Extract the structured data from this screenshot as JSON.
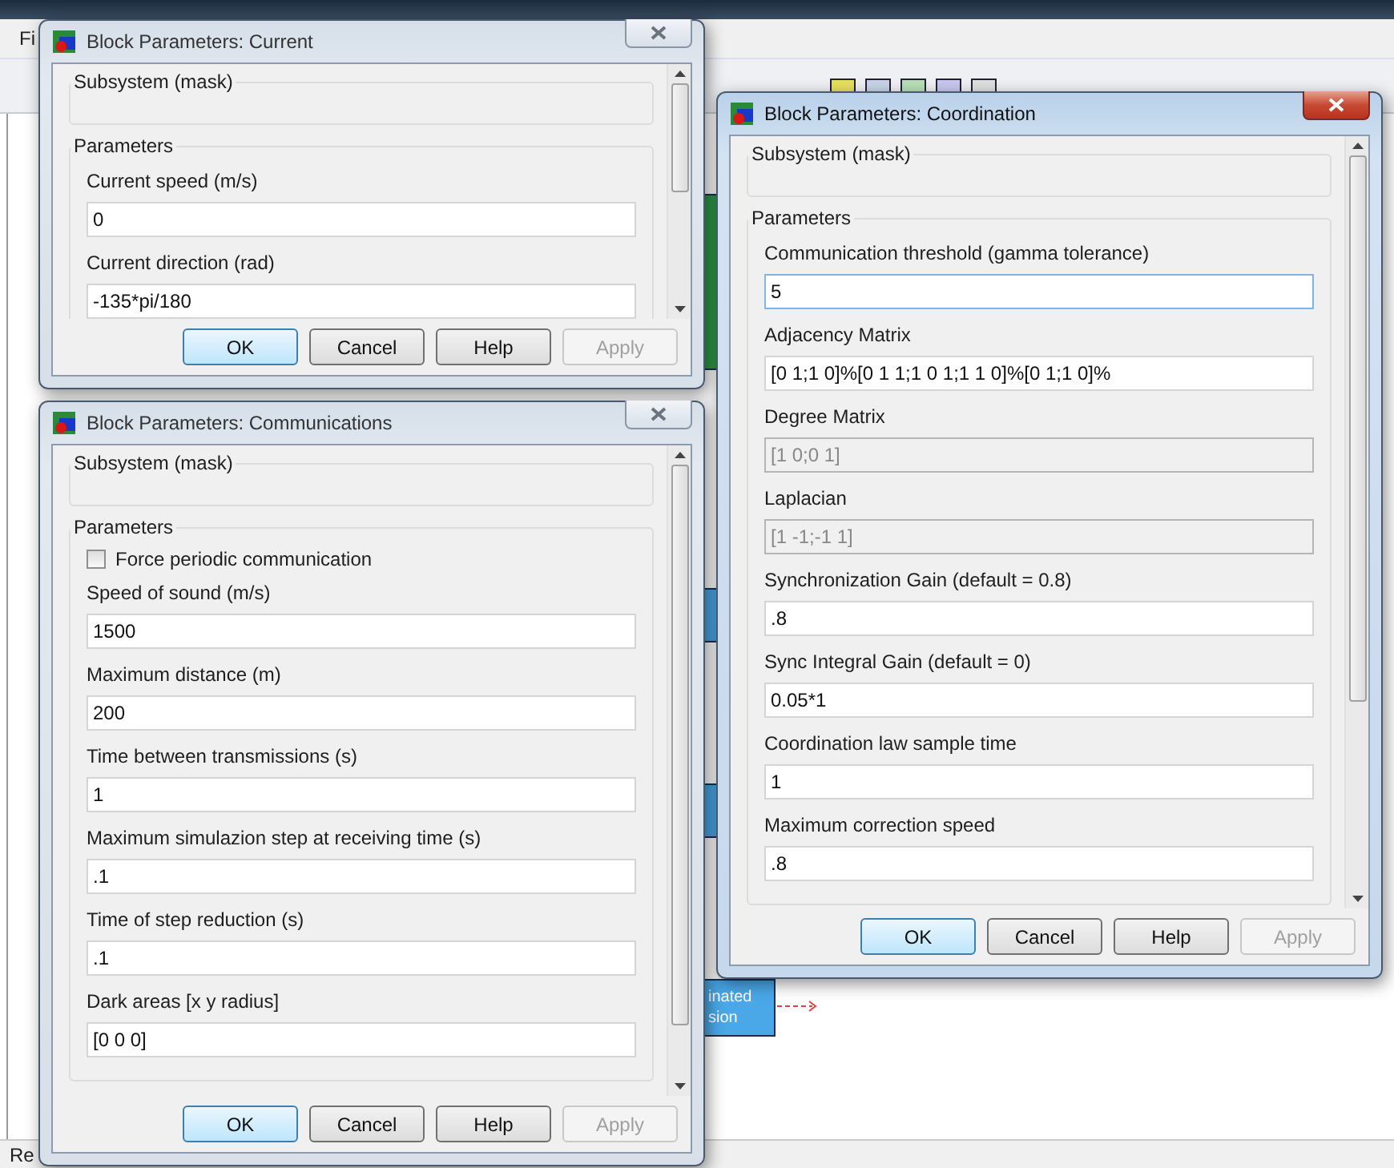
{
  "background": {
    "menu_fragment": "Fi",
    "status_fragment": "Re",
    "block_text": [
      "inated",
      "sion"
    ]
  },
  "dialogs": [
    {
      "title": "Block Parameters: Current",
      "active": false,
      "group_title": "Subsystem (mask)",
      "parameters_title": "Parameters",
      "fields": [
        {
          "kind": "text",
          "label": "Current speed (m/s)",
          "value": "0",
          "disabled": false,
          "focused": false
        },
        {
          "kind": "text",
          "label": "Current direction (rad)",
          "value": "-135*pi/180",
          "disabled": false,
          "focused": false
        }
      ],
      "buttons": [
        {
          "label": "OK",
          "default": true,
          "disabled": false
        },
        {
          "label": "Cancel",
          "default": false,
          "disabled": false
        },
        {
          "label": "Help",
          "default": false,
          "disabled": false
        },
        {
          "label": "Apply",
          "default": false,
          "disabled": true
        }
      ]
    },
    {
      "title": "Block Parameters: Communications",
      "active": false,
      "group_title": "Subsystem (mask)",
      "parameters_title": "Parameters",
      "fields": [
        {
          "kind": "checkbox",
          "label": "Force periodic communication",
          "checked": false
        },
        {
          "kind": "text",
          "label": "Speed of sound (m/s)",
          "value": "1500",
          "disabled": false,
          "focused": false
        },
        {
          "kind": "text",
          "label": "Maximum distance (m)",
          "value": "200",
          "disabled": false,
          "focused": false
        },
        {
          "kind": "text",
          "label": "Time between transmissions (s)",
          "value": "1",
          "disabled": false,
          "focused": false
        },
        {
          "kind": "text",
          "label": "Maximum simulazion step at receiving time (s)",
          "value": ".1",
          "disabled": false,
          "focused": false
        },
        {
          "kind": "text",
          "label": "Time of step reduction (s)",
          "value": ".1",
          "disabled": false,
          "focused": false
        },
        {
          "kind": "text",
          "label": "Dark areas [x y radius]",
          "value": "[0 0 0]",
          "disabled": false,
          "focused": false
        }
      ],
      "buttons": [
        {
          "label": "OK",
          "default": true,
          "disabled": false
        },
        {
          "label": "Cancel",
          "default": false,
          "disabled": false
        },
        {
          "label": "Help",
          "default": false,
          "disabled": false
        },
        {
          "label": "Apply",
          "default": false,
          "disabled": true
        }
      ]
    },
    {
      "title": "Block Parameters: Coordination",
      "active": true,
      "group_title": "Subsystem (mask)",
      "parameters_title": "Parameters",
      "fields": [
        {
          "kind": "text",
          "label": "Communication threshold (gamma tolerance)",
          "value": "5",
          "disabled": false,
          "focused": true
        },
        {
          "kind": "text",
          "label": "Adjacency Matrix",
          "value": "[0 1;1 0]%[0 1 1;1 0 1;1 1 0]%[0 1;1 0]%",
          "disabled": false,
          "focused": false
        },
        {
          "kind": "text",
          "label": "Degree Matrix",
          "value": "[1 0;0 1]",
          "disabled": true,
          "focused": false
        },
        {
          "kind": "text",
          "label": "Laplacian",
          "value": "[1 -1;-1 1]",
          "disabled": true,
          "focused": false
        },
        {
          "kind": "text",
          "label": "Synchronization Gain (default = 0.8)",
          "value": ".8",
          "disabled": false,
          "focused": false
        },
        {
          "kind": "text",
          "label": "Sync Integral Gain (default = 0)",
          "value": "0.05*1",
          "disabled": false,
          "focused": false
        },
        {
          "kind": "text",
          "label": "Coordination law sample time",
          "value": "1",
          "disabled": false,
          "focused": false
        },
        {
          "kind": "text",
          "label": "Maximum correction speed",
          "value": ".8",
          "disabled": false,
          "focused": false
        }
      ],
      "buttons": [
        {
          "label": "OK",
          "default": true,
          "disabled": false
        },
        {
          "label": "Cancel",
          "default": false,
          "disabled": false
        },
        {
          "label": "Help",
          "default": false,
          "disabled": false
        },
        {
          "label": "Apply",
          "default": false,
          "disabled": true
        }
      ]
    }
  ]
}
